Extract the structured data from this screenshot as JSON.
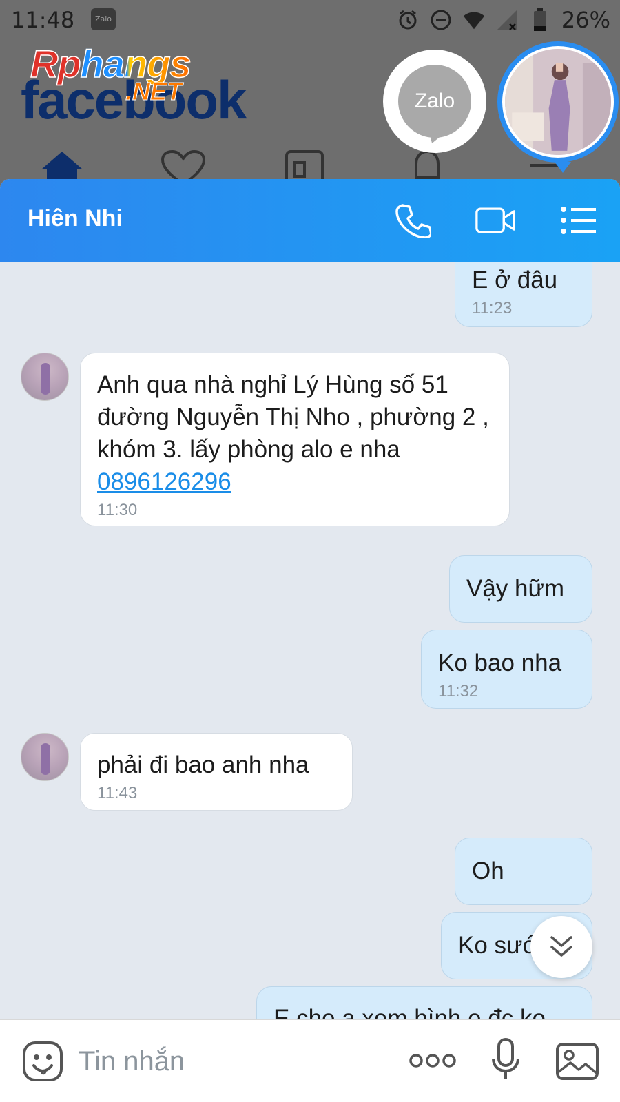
{
  "status_bar": {
    "time": "11:48",
    "notification_app": "Zalo",
    "battery": "26%"
  },
  "background_app": {
    "logo_text": "Rphangs",
    "logo_suffix": ".NET",
    "underlying_text": "facebook"
  },
  "floating": {
    "zalo_bubble_label": "Zalo"
  },
  "chat": {
    "contact_name": "Hiên Nhi",
    "messages": [
      {
        "direction": "out",
        "text": "E ở đâu",
        "time": "11:23"
      },
      {
        "direction": "in",
        "text": "Anh qua nhà nghỉ Lý Hùng số 51 đường Nguyễn Thị Nho , phường 2 , khóm 3.  lấy phòng alo e nha",
        "link": "0896126296",
        "time": "11:30"
      },
      {
        "direction": "out",
        "text": "Vậy hữm",
        "time": ""
      },
      {
        "direction": "out",
        "text": "Ko bao nha",
        "time": "11:32"
      },
      {
        "direction": "in",
        "text": "phải đi bao anh nha",
        "time": "11:43"
      },
      {
        "direction": "out",
        "text": "Oh",
        "time": ""
      },
      {
        "direction": "out",
        "text": "Ko sướ",
        "time": ""
      },
      {
        "direction": "out",
        "text": "E cho a xem hình e đc ko",
        "time": ""
      }
    ]
  },
  "composer": {
    "placeholder": "Tin nhắn"
  },
  "colors": {
    "header_start": "#2d87ef",
    "header_end": "#1aa2f5",
    "outgoing_bubble": "#d5ebfb",
    "incoming_bubble": "#ffffff",
    "link": "#1a8de8"
  }
}
